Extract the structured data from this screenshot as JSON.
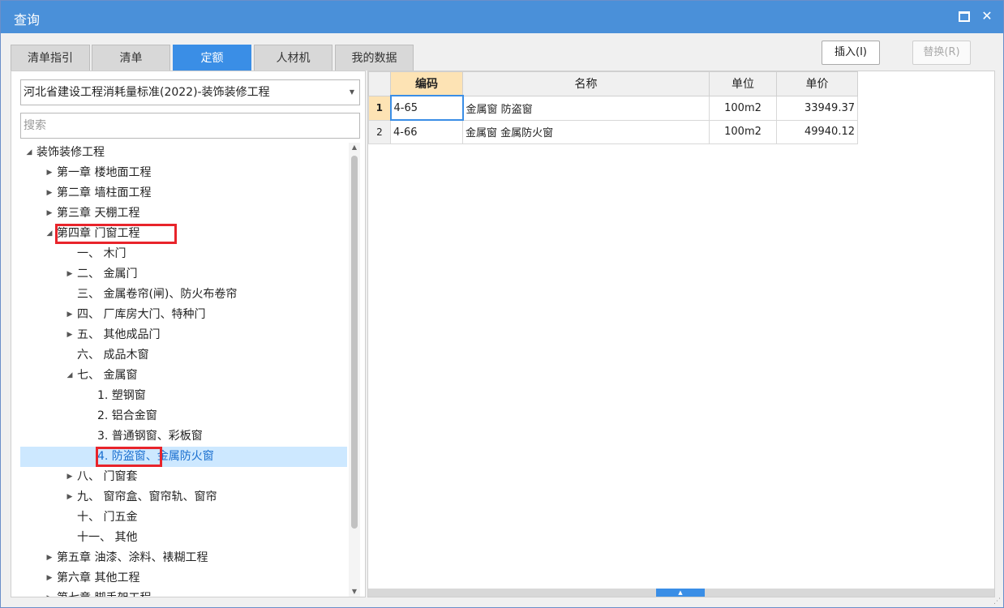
{
  "window": {
    "title": "查询"
  },
  "tabs": [
    {
      "label": "清单指引"
    },
    {
      "label": "清单"
    },
    {
      "label": "定额",
      "active": true
    },
    {
      "label": "人材机"
    },
    {
      "label": "我的数据"
    }
  ],
  "buttons": {
    "insert": "插入(I)",
    "replace": "替换(R)"
  },
  "library_select": {
    "value": "河北省建设工程消耗量标准(2022)-装饰装修工程"
  },
  "search": {
    "placeholder": "搜索"
  },
  "tree": [
    {
      "label": "装饰装修工程",
      "level": 0,
      "expander": "expanded"
    },
    {
      "label": "第一章 楼地面工程",
      "level": 1,
      "expander": "collapsed"
    },
    {
      "label": "第二章 墙柱面工程",
      "level": 1,
      "expander": "collapsed"
    },
    {
      "label": "第三章 天棚工程",
      "level": 1,
      "expander": "collapsed"
    },
    {
      "label": "第四章 门窗工程",
      "level": 1,
      "expander": "expanded",
      "highlighted": true
    },
    {
      "label": "一、 木门",
      "level": 2,
      "expander": "none"
    },
    {
      "label": "二、 金属门",
      "level": 2,
      "expander": "collapsed"
    },
    {
      "label": "三、 金属卷帘(闸)、防火布卷帘",
      "level": 2,
      "expander": "none"
    },
    {
      "label": "四、 厂库房大门、特种门",
      "level": 2,
      "expander": "collapsed"
    },
    {
      "label": "五、 其他成品门",
      "level": 2,
      "expander": "collapsed"
    },
    {
      "label": "六、 成品木窗",
      "level": 2,
      "expander": "none"
    },
    {
      "label": "七、 金属窗",
      "level": 2,
      "expander": "expanded"
    },
    {
      "label": "1. 塑钢窗",
      "level": 3,
      "expander": "none"
    },
    {
      "label": "2. 铝合金窗",
      "level": 3,
      "expander": "none"
    },
    {
      "label": "3. 普通钢窗、彩板窗",
      "level": 3,
      "expander": "none"
    },
    {
      "label": "4. 防盗窗、金属防火窗",
      "level": 3,
      "expander": "none",
      "selected": true,
      "highlighted": true
    },
    {
      "label": "八、 门窗套",
      "level": 2,
      "expander": "collapsed"
    },
    {
      "label": "九、 窗帘盒、窗帘轨、窗帘",
      "level": 2,
      "expander": "collapsed"
    },
    {
      "label": "十、 门五金",
      "level": 2,
      "expander": "none"
    },
    {
      "label": "十一、 其他",
      "level": 2,
      "expander": "none"
    },
    {
      "label": "第五章 油漆、涂料、裱糊工程",
      "level": 1,
      "expander": "collapsed"
    },
    {
      "label": "第六章 其他工程",
      "level": 1,
      "expander": "collapsed"
    },
    {
      "label": "第七章 脚手架工程",
      "level": 1,
      "expander": "collapsed"
    }
  ],
  "grid": {
    "headers": {
      "code": "编码",
      "name": "名称",
      "unit": "单位",
      "price": "单价"
    },
    "rows": [
      {
        "no": "1",
        "code": "4-65",
        "name": "金属窗 防盗窗",
        "unit": "100m2",
        "price": "33949.37"
      },
      {
        "no": "2",
        "code": "4-66",
        "name": "金属窗 金属防火窗",
        "unit": "100m2",
        "price": "49940.12"
      }
    ]
  },
  "colors": {
    "accent": "#3a8ee6",
    "titlebar": "#4a90d9",
    "header_highlight": "#fde3b4",
    "highlight_box": "#e8242b",
    "selected_row": "#cde8ff"
  },
  "icons": {
    "maximize": "maximize-icon",
    "close": "close-icon",
    "dropdown": "chevron-down-icon",
    "expanded": "triangle-down-icon",
    "collapsed": "triangle-right-icon",
    "resize": "resize-grip-icon"
  }
}
